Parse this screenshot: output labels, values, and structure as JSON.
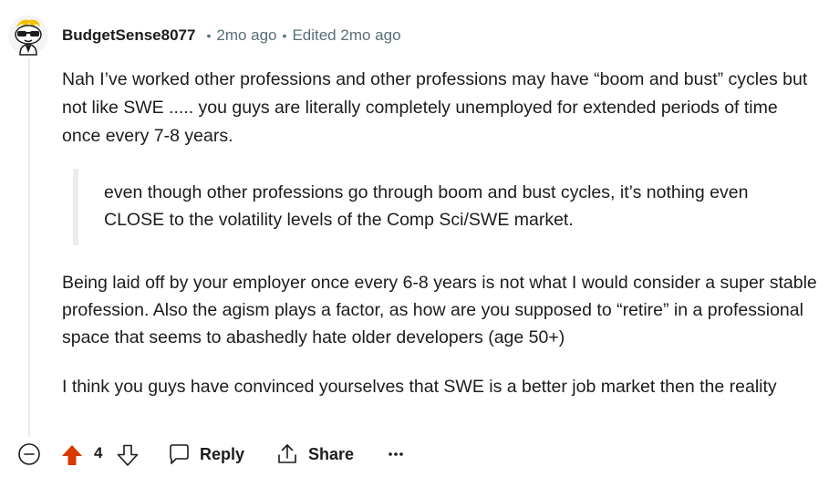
{
  "comment": {
    "username": "BudgetSense8077",
    "timestamp": "2mo ago",
    "edited": "Edited 2mo ago",
    "separator": "•",
    "paragraphs": [
      "Nah I’ve worked other professions and other professions may have “boom and bust” cycles but not like SWE ..... you guys are literally completely unemployed for extended periods of time once every 7-8 years.",
      "Being laid off by your employer once every 6-8 years is not what I would consider a super stable profession. Also the agism plays a factor, as how are you supposed to “retire” in a professional space that seems to abashedly hate older developers (age 50+)",
      "I think you guys have convinced yourselves that SWE is a better job market then the reality"
    ],
    "quote": "even though other professions go through boom and bust cycles, it’s nothing even CLOSE to the volatility levels of the Comp Sci/SWE market."
  },
  "actions": {
    "vote_count": "4",
    "reply_label": "Reply",
    "share_label": "Share",
    "more_label": "···"
  },
  "icons": {
    "collapse": "minus-circle-icon",
    "upvote": "upvote-filled-icon",
    "downvote": "downvote-outline-icon",
    "reply": "comment-bubble-icon",
    "share": "share-upload-icon",
    "more": "ellipsis-icon"
  },
  "colors": {
    "upvote_active": "#d93a00",
    "muted_text": "#576f76",
    "thread_line": "#e5ebee",
    "quote_border": "#e9edef"
  }
}
